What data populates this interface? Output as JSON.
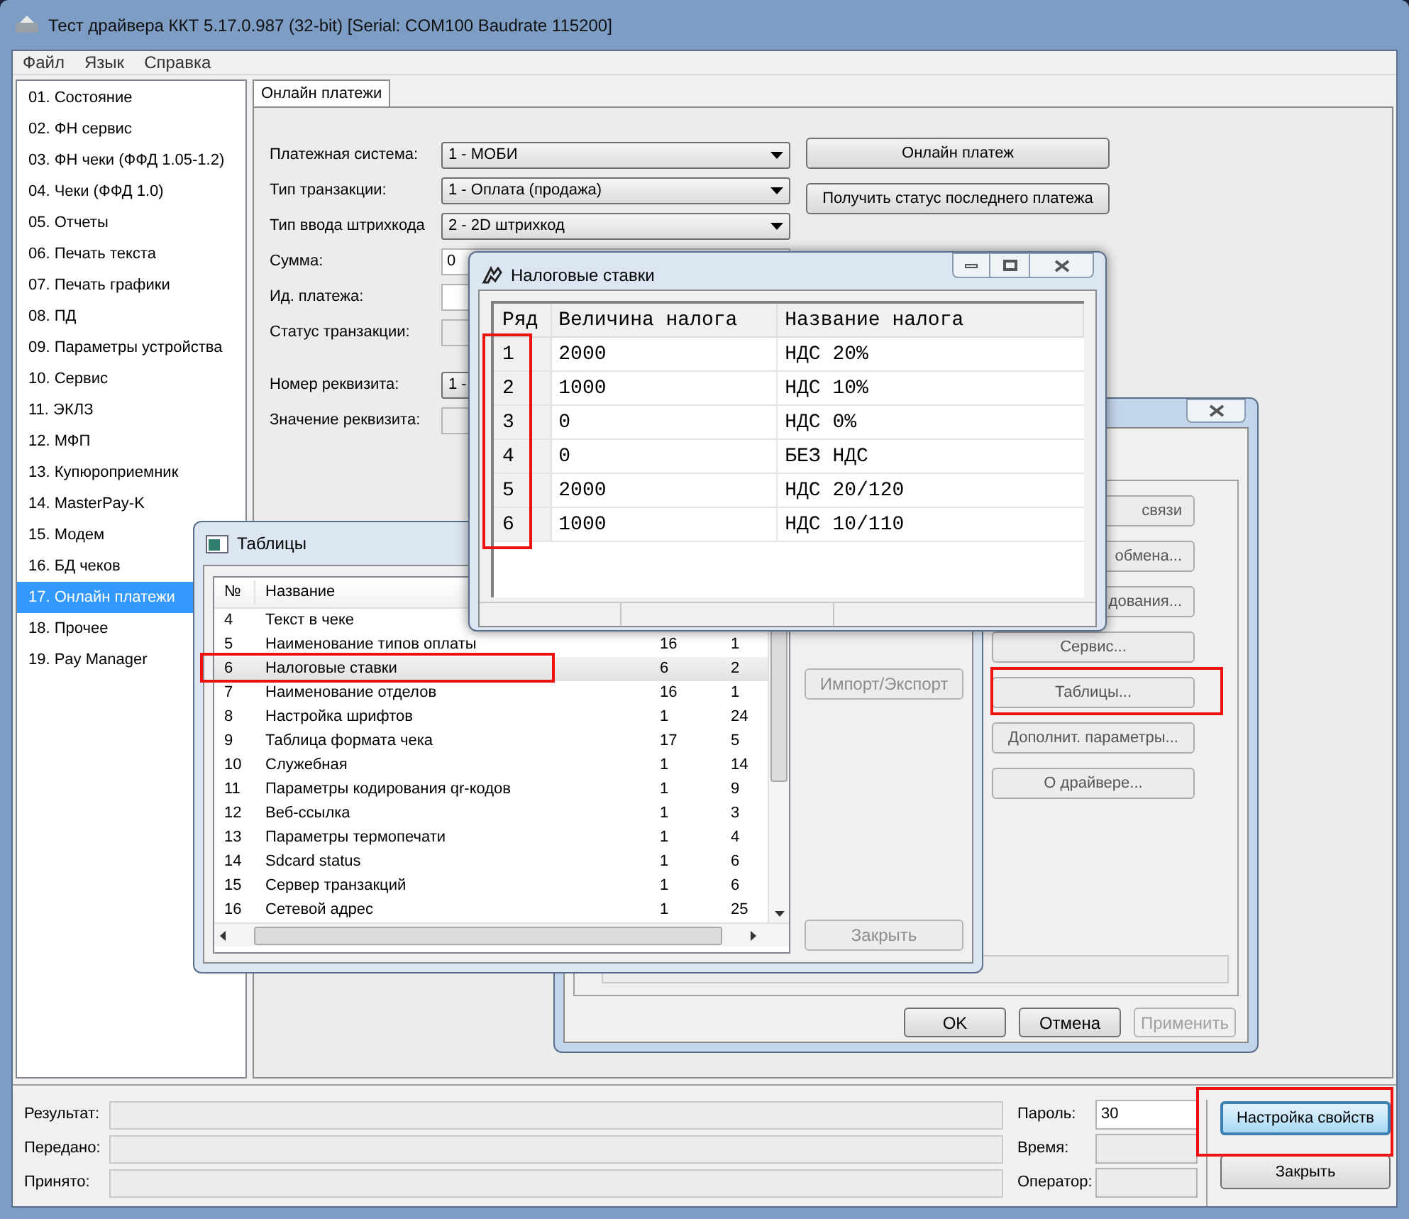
{
  "window": {
    "title": "Тест драйвера ККТ 5.17.0.987 (32-bit) [Serial: COM100 Baudrate 115200]",
    "menu": [
      "Файл",
      "Язык",
      "Справка"
    ]
  },
  "sidebar": {
    "items": [
      {
        "label": "01. Состояние",
        "selected": false
      },
      {
        "label": "02. ФН сервис",
        "selected": false
      },
      {
        "label": "03. ФН чеки (ФФД 1.05-1.2)",
        "selected": false
      },
      {
        "label": "04. Чеки (ФФД 1.0)",
        "selected": false
      },
      {
        "label": "05. Отчеты",
        "selected": false
      },
      {
        "label": "06. Печать текста",
        "selected": false
      },
      {
        "label": "07. Печать графики",
        "selected": false
      },
      {
        "label": "08. ПД",
        "selected": false
      },
      {
        "label": "09. Параметры устройства",
        "selected": false
      },
      {
        "label": "10. Сервис",
        "selected": false
      },
      {
        "label": "11. ЭКЛЗ",
        "selected": false
      },
      {
        "label": "12. МФП",
        "selected": false
      },
      {
        "label": "13. Купюроприемник",
        "selected": false
      },
      {
        "label": "14. MasterPay-K",
        "selected": false
      },
      {
        "label": "15. Модем",
        "selected": false
      },
      {
        "label": "16. БД чеков",
        "selected": false
      },
      {
        "label": "17. Онлайн платежи",
        "selected": true
      },
      {
        "label": "18. Прочее",
        "selected": false
      },
      {
        "label": "19. Pay Manager",
        "selected": false
      }
    ]
  },
  "tabs": [
    {
      "label": "Онлайн платежи",
      "selected": true
    }
  ],
  "form": {
    "fields": [
      {
        "label": "Платежная система:",
        "kind": "combo",
        "value": "1 - МОБИ",
        "disabled": false
      },
      {
        "label": "Тип транзакции:",
        "kind": "combo",
        "value": "1 - Оплата (продажа)",
        "disabled": false
      },
      {
        "label": "Тип ввода штрихкода",
        "kind": "combo",
        "value": "2 - 2D штрихкод",
        "disabled": false
      },
      {
        "label": "Сумма:",
        "kind": "text",
        "value": "0",
        "disabled": false
      },
      {
        "label": "Ид. платежа:",
        "kind": "text",
        "disabled": false
      },
      {
        "label": "Статус транзакции:",
        "kind": "text",
        "disabled": true
      },
      {
        "label": "Номер реквизита:",
        "kind": "combo",
        "value": "1 -",
        "disabled": false
      },
      {
        "label": "Значение реквизита:",
        "kind": "text",
        "disabled": true
      }
    ],
    "buttons": [
      "Онлайн платеж",
      "Получить статус последнего платежа"
    ]
  },
  "status_panel": {
    "fields": [
      {
        "label": "Результат:"
      },
      {
        "label": "Передано:"
      },
      {
        "label": "Принято:"
      }
    ],
    "side_fields": [
      {
        "label": "Пароль:",
        "value": "30",
        "disabled": false
      },
      {
        "label": "Время:",
        "disabled": true
      },
      {
        "label": "Оператор:",
        "disabled": true
      }
    ],
    "buttons": [
      {
        "label": "Настройка свойств",
        "focused": true
      },
      {
        "label": "Закрыть",
        "focused": false
      }
    ]
  },
  "properties_dialog": {
    "buttons": [
      {
        "label": "связи",
        "disabled": false
      },
      {
        "label": "обмена...",
        "disabled": false
      },
      {
        "label": "дования...",
        "disabled": false
      },
      {
        "label": "Сервис...",
        "disabled": false
      },
      {
        "label": "Таблицы...",
        "disabled": false
      },
      {
        "label": "Дополнит. параметры...",
        "disabled": false
      },
      {
        "label": "О драйвере...",
        "disabled": false
      }
    ],
    "footer_buttons": [
      {
        "label": "OK",
        "disabled": false
      },
      {
        "label": "Отмена",
        "disabled": false
      },
      {
        "label": "Применить",
        "disabled": true
      }
    ]
  },
  "tables_dialog": {
    "title": "Таблицы",
    "columns": [
      "№",
      "Название"
    ],
    "rows": [
      {
        "cells": [
          "4",
          "Текст в чеке"
        ],
        "selected": false
      },
      {
        "cells": [
          "5",
          "Наименование типов оплаты",
          "16",
          "1"
        ],
        "selected": false
      },
      {
        "cells": [
          "6",
          "Налоговые ставки",
          "6",
          "2"
        ],
        "selected": true
      },
      {
        "cells": [
          "7",
          "Наименование отделов",
          "16",
          "1"
        ],
        "selected": false
      },
      {
        "cells": [
          "8",
          "Настройка шрифтов",
          "1",
          "24"
        ],
        "selected": false
      },
      {
        "cells": [
          "9",
          "Таблица формата чека",
          "17",
          "5"
        ],
        "selected": false
      },
      {
        "cells": [
          "10",
          "Служебная",
          "1",
          "14"
        ],
        "selected": false
      },
      {
        "cells": [
          "11",
          "Параметры кодирования qr-кодов",
          "1",
          "9"
        ],
        "selected": false
      },
      {
        "cells": [
          "12",
          "Веб-ссылка",
          "1",
          "3"
        ],
        "selected": false
      },
      {
        "cells": [
          "13",
          "Параметры термопечати",
          "1",
          "4"
        ],
        "selected": false
      },
      {
        "cells": [
          "14",
          "Sdcard status",
          "1",
          "6"
        ],
        "selected": false
      },
      {
        "cells": [
          "15",
          "Сервер транзакций",
          "1",
          "6"
        ],
        "selected": false
      },
      {
        "cells": [
          "16",
          "Сетевой адрес",
          "1",
          "25"
        ],
        "selected": false
      }
    ],
    "buttons": [
      {
        "label": "Импорт/Экспорт",
        "disabled": true
      },
      {
        "label": "Закрыть",
        "disabled": true
      }
    ]
  },
  "tax_dialog": {
    "title": "Налоговые ставки",
    "columns": [
      "Ряд",
      "Величина налога",
      "Название налога"
    ],
    "rows": [
      [
        "1",
        "2000",
        "НДС 20%"
      ],
      [
        "2",
        "1000",
        "НДС 10%"
      ],
      [
        "3",
        "0",
        "НДС 0%"
      ],
      [
        "4",
        "0",
        "БЕЗ НДС"
      ],
      [
        "5",
        "2000",
        "НДС 20/120"
      ],
      [
        "6",
        "1000",
        "НДС 10/110"
      ]
    ]
  }
}
